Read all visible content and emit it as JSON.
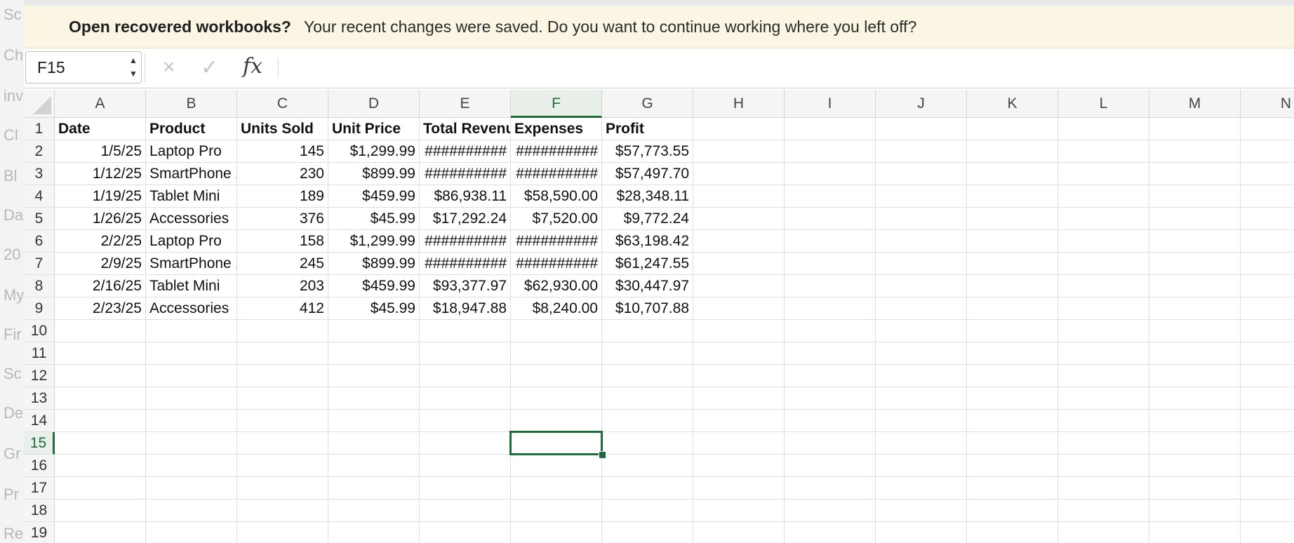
{
  "background_window": {
    "fragments": [
      "Sc",
      "Ch",
      "inv",
      "Cl",
      "Bl",
      "Da",
      "20",
      "My",
      "Fir",
      "Sc",
      "De",
      "Gr",
      "Pr",
      "Re"
    ]
  },
  "banner": {
    "title": "Open recovered workbooks?",
    "message": "Your recent changes were saved. Do you want to continue working where you left off?"
  },
  "formula_bar": {
    "name_box": "F15",
    "cancel_icon": "×",
    "enter_icon": "✓",
    "fx_label": "fx",
    "formula": ""
  },
  "sheet": {
    "columns": [
      "A",
      "B",
      "C",
      "D",
      "E",
      "F",
      "G",
      "H",
      "I",
      "J",
      "K",
      "L",
      "M",
      "N"
    ],
    "row_numbers": [
      "1",
      "2",
      "3",
      "4",
      "5",
      "6",
      "7",
      "8",
      "9",
      "10",
      "11",
      "12",
      "13",
      "14",
      "15",
      "16",
      "17",
      "18",
      "19"
    ],
    "active_column": "F",
    "active_row": "15",
    "header_row": [
      "Date",
      "Product",
      "Units Sold",
      "Unit Price",
      "Total Revenu",
      "Expenses",
      "Profit"
    ],
    "rows": [
      [
        "1/5/25",
        "Laptop Pro",
        "145",
        "$1,299.99",
        "##########",
        "##########",
        "$57,773.55"
      ],
      [
        "1/12/25",
        "SmartPhone X",
        "230",
        "$899.99",
        "##########",
        "##########",
        "$57,497.70"
      ],
      [
        "1/19/25",
        "Tablet Mini",
        "189",
        "$459.99",
        "$86,938.11",
        "$58,590.00",
        "$28,348.11"
      ],
      [
        "1/26/25",
        "Accessories",
        "376",
        "$45.99",
        "$17,292.24",
        "$7,520.00",
        "$9,772.24"
      ],
      [
        "2/2/25",
        "Laptop Pro",
        "158",
        "$1,299.99",
        "##########",
        "##########",
        "$63,198.42"
      ],
      [
        "2/9/25",
        "SmartPhone X",
        "245",
        "$899.99",
        "##########",
        "##########",
        "$61,247.55"
      ],
      [
        "2/16/25",
        "Tablet Mini",
        "203",
        "$459.99",
        "$93,377.97",
        "$62,930.00",
        "$30,447.97"
      ],
      [
        "2/23/25",
        "Accessories",
        "412",
        "$45.99",
        "$18,947.88",
        "$8,240.00",
        "$10,707.88"
      ]
    ]
  },
  "colors": {
    "accent_green": "#1d6b3a",
    "banner_bg": "#fbf5e3"
  }
}
